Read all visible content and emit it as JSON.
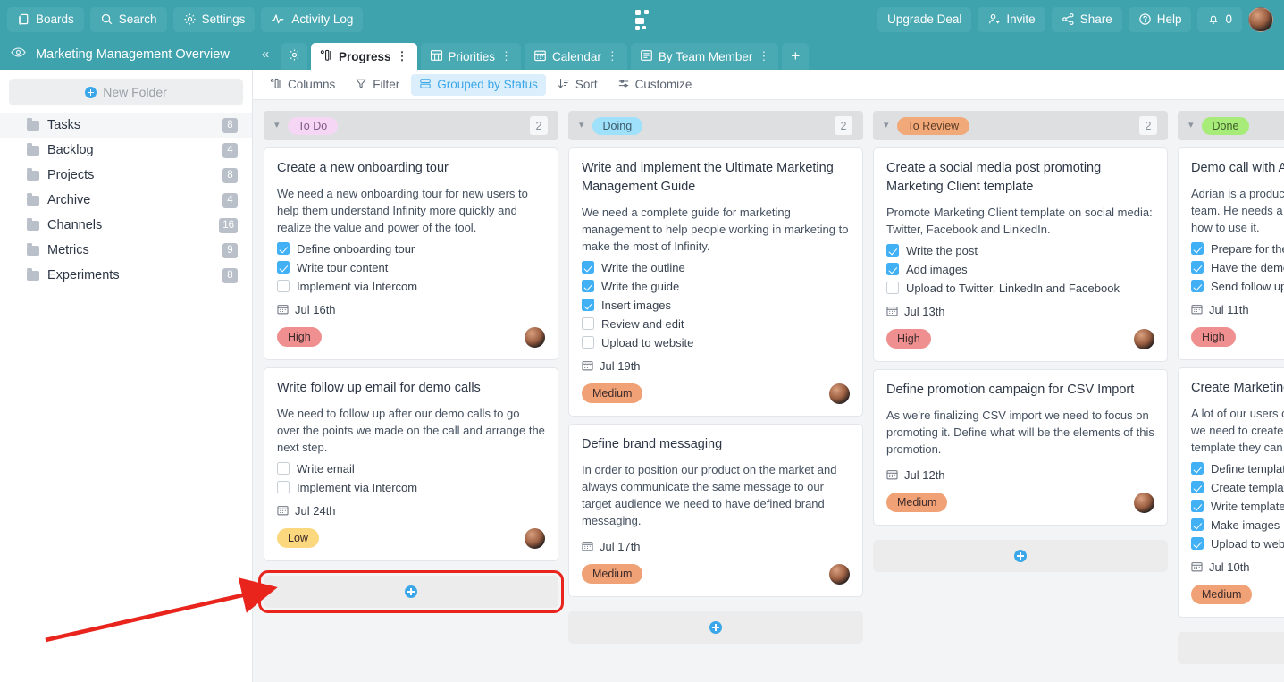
{
  "topbar": {
    "left_buttons": [
      {
        "label": "Boards",
        "icon": "boards-icon"
      },
      {
        "label": "Search",
        "icon": "search-icon"
      },
      {
        "label": "Settings",
        "icon": "gear-icon"
      },
      {
        "label": "Activity Log",
        "icon": "activity-icon"
      }
    ],
    "logo": "infinity-logo",
    "right_buttons": [
      {
        "label": "Upgrade Deal",
        "icon": ""
      },
      {
        "label": "Invite",
        "icon": "invite-user-icon"
      },
      {
        "label": "Share",
        "icon": "share-icon"
      },
      {
        "label": "Help",
        "icon": "help-circle-icon"
      },
      {
        "label": "0",
        "icon": "bell-icon"
      }
    ],
    "avatar": "user-avatar",
    "bg_color": "#3fa3ae"
  },
  "board_header": {
    "eye_icon": "eye-icon",
    "title": "Marketing Management Overview",
    "collapse_icon": "«",
    "tabs": [
      {
        "label": "",
        "icon": "gear-icon",
        "active": false,
        "has_dots": false
      },
      {
        "label": "Progress",
        "icon": "columns-icon",
        "active": true,
        "has_dots": true
      },
      {
        "label": "Priorities",
        "icon": "table-icon",
        "active": false,
        "has_dots": true
      },
      {
        "label": "Calendar",
        "icon": "calendar-icon",
        "active": false,
        "has_dots": true
      },
      {
        "label": "By Team Member",
        "icon": "list-icon",
        "active": false,
        "has_dots": true
      }
    ],
    "add_tab_label": "+"
  },
  "sidebar": {
    "new_folder_label": "New Folder",
    "folders": [
      {
        "label": "Tasks",
        "count": "8",
        "selected": true
      },
      {
        "label": "Backlog",
        "count": "4",
        "selected": false
      },
      {
        "label": "Projects",
        "count": "8",
        "selected": false
      },
      {
        "label": "Archive",
        "count": "4",
        "selected": false
      },
      {
        "label": "Channels",
        "count": "16",
        "selected": false
      },
      {
        "label": "Metrics",
        "count": "9",
        "selected": false
      },
      {
        "label": "Experiments",
        "count": "8",
        "selected": false
      }
    ]
  },
  "view_toolbar": {
    "items": [
      {
        "label": "Columns",
        "icon": "columns-icon",
        "active": false
      },
      {
        "label": "Filter",
        "icon": "filter-icon",
        "active": false
      },
      {
        "label": "Grouped by Status",
        "icon": "group-icon",
        "active": true
      },
      {
        "label": "Sort",
        "icon": "sort-icon",
        "active": false
      },
      {
        "label": "Customize",
        "icon": "customize-icon",
        "active": false
      }
    ],
    "active_color": "#3ba7e8"
  },
  "board": {
    "add_card_icon": "plus-circle-icon",
    "columns": [
      {
        "status": "To Do",
        "pill_bg": "#f5d6f5",
        "pill_color": "#7e5a86",
        "count": "2",
        "highlight_add": true,
        "cards": [
          {
            "title": "Create a new onboarding tour",
            "description": "We need a new onboarding tour for new users to help them understand Infinity more quickly and realize the value and power of the tool.",
            "subtasks": [
              {
                "label": "Define onboarding tour",
                "done": true
              },
              {
                "label": "Write tour content",
                "done": true
              },
              {
                "label": "Implement via Intercom",
                "done": false
              }
            ],
            "date": "Jul 16th",
            "priority": "High",
            "priority_bg": "#ef8f8f",
            "avatar": "assignee-avatar"
          },
          {
            "title": "Write follow up email for demo calls",
            "description": "We need to follow up after our demo calls to go over the points we made on the call and arrange the next step.",
            "subtasks": [
              {
                "label": "Write email",
                "done": false
              },
              {
                "label": "Implement via Intercom",
                "done": false
              }
            ],
            "date": "Jul 24th",
            "priority": "Low",
            "priority_bg": "#fbd87d",
            "avatar": "assignee-avatar"
          }
        ]
      },
      {
        "status": "Doing",
        "pill_bg": "#9fe1fb",
        "pill_color": "#3f5a6b",
        "count": "2",
        "highlight_add": false,
        "cards": [
          {
            "title": "Write and implement the Ultimate Marketing Management Guide",
            "description": "We need a complete guide for marketing management to help people working in marketing to make the most of Infinity.",
            "subtasks": [
              {
                "label": "Write the outline",
                "done": true
              },
              {
                "label": "Write the guide",
                "done": true
              },
              {
                "label": "Insert images",
                "done": true
              },
              {
                "label": "Review and edit",
                "done": false
              },
              {
                "label": "Upload to website",
                "done": false
              }
            ],
            "date": "Jul 19th",
            "priority": "Medium",
            "priority_bg": "#f0a175",
            "avatar": "assignee-avatar"
          },
          {
            "title": "Define brand messaging",
            "description": "In order to position our product on the market and always communicate the same message to our target audience we need to have defined brand messaging.",
            "subtasks": [],
            "date": "Jul 17th",
            "priority": "Medium",
            "priority_bg": "#f0a175",
            "avatar": "assignee-avatar"
          }
        ]
      },
      {
        "status": "To Review",
        "pill_bg": "#f2a97a",
        "pill_color": "#5c3c26",
        "count": "2",
        "highlight_add": false,
        "cards": [
          {
            "title": "Create a social media post promoting Marketing Client template",
            "description": "Promote Marketing Client template on social media: Twitter, Facebook and LinkedIn.",
            "subtasks": [
              {
                "label": "Write the post",
                "done": true
              },
              {
                "label": "Add images",
                "done": true
              },
              {
                "label": "Upload to Twitter, LinkedIn and Facebook",
                "done": false
              }
            ],
            "date": "Jul 13th",
            "priority": "High",
            "priority_bg": "#ef8f8f",
            "avatar": "assignee-avatar"
          },
          {
            "title": "Define promotion campaign for CSV Import",
            "description": "As we're finalizing CSV import we need to focus on promoting it. Define what will be the elements of this promotion.",
            "subtasks": [],
            "date": "Jul 12th",
            "priority": "Medium",
            "priority_bg": "#f0a175",
            "avatar": "assignee-avatar"
          }
        ]
      },
      {
        "status": "Done",
        "pill_bg": "#a7eb79",
        "pill_color": "#3e5c2b",
        "count": "",
        "highlight_add": false,
        "cards": [
          {
            "title": "Demo call with Adrian",
            "description": "Adrian is a product manager leading the product team. He needs a demo of Infinity and some tips how to use it.",
            "subtasks": [
              {
                "label": "Prepare for the call",
                "done": true
              },
              {
                "label": "Have the demo call",
                "done": true
              },
              {
                "label": "Send follow up email",
                "done": true
              }
            ],
            "date": "Jul 11th",
            "priority": "High",
            "priority_bg": "#ef8f8f",
            "avatar": "assignee-avatar"
          },
          {
            "title": "Create Marketing Client template",
            "description": "A lot of our users come from the marketing niche, we need to create a complete marketing client template they can use in their organization.",
            "subtasks": [
              {
                "label": "Define template structure",
                "done": true
              },
              {
                "label": "Create template",
                "done": true
              },
              {
                "label": "Write template copy",
                "done": true
              },
              {
                "label": "Make images",
                "done": true
              },
              {
                "label": "Upload to website",
                "done": true
              }
            ],
            "date": "Jul 10th",
            "priority": "Medium",
            "priority_bg": "#f0a175",
            "avatar": "assignee-avatar"
          }
        ]
      }
    ]
  },
  "annotation": {
    "type": "arrow",
    "color": "#e8241d",
    "points_to": "add-card-button-todo"
  }
}
